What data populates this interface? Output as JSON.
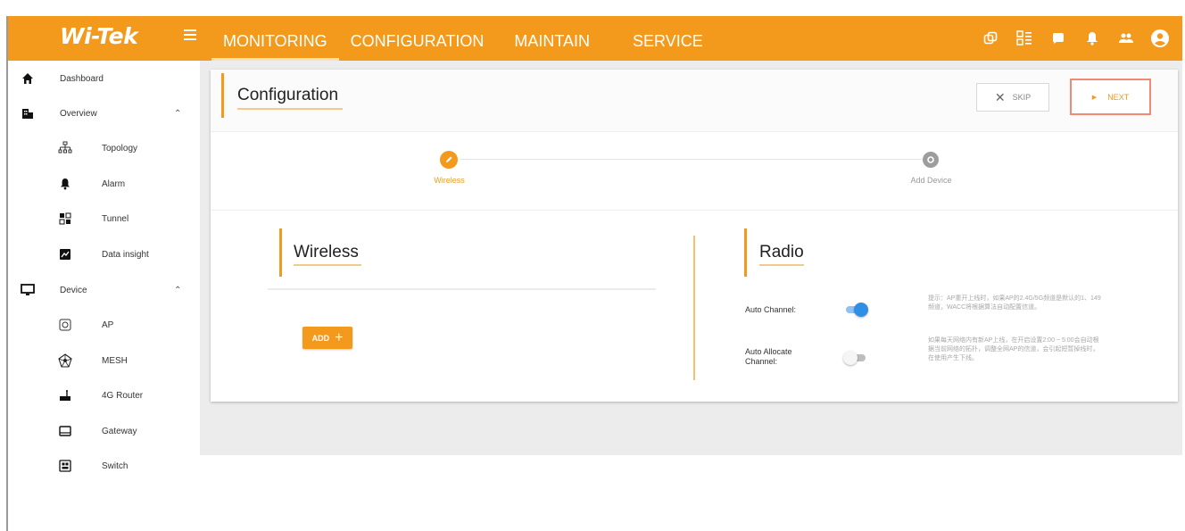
{
  "brand": {
    "logo_text": "Wi-Tek",
    "logo_tagline": "",
    "accent_color": "#f39a1c",
    "nav_text_color": "#ffffff"
  },
  "topnav": {
    "items": [
      {
        "label": "MONITORING",
        "active": true
      },
      {
        "label": "CONFIGURATION",
        "active": false
      },
      {
        "label": "MAINTAIN",
        "active": false
      },
      {
        "label": "SERVICE",
        "active": false
      }
    ],
    "icons": [
      "link-icon",
      "qr-grid-icon",
      "chat-icon",
      "bell-icon",
      "users-icon",
      "account-icon"
    ]
  },
  "sidebar": {
    "items": [
      {
        "label": "Dashboard",
        "icon": "home-icon",
        "level": "parent"
      },
      {
        "label": "Overview",
        "icon": "building-icon",
        "level": "parent",
        "expanded": true
      },
      {
        "label": "Topology",
        "icon": "topology-icon",
        "level": "child"
      },
      {
        "label": "Alarm",
        "icon": "bell-icon",
        "level": "child"
      },
      {
        "label": "Tunnel",
        "icon": "tunnel-icon",
        "level": "child"
      },
      {
        "label": "Data insight",
        "icon": "chart-icon",
        "level": "child"
      },
      {
        "label": "Device",
        "icon": "monitor-icon",
        "level": "parent",
        "expanded": true
      },
      {
        "label": "AP",
        "icon": "ap-icon",
        "level": "child"
      },
      {
        "label": "MESH",
        "icon": "mesh-icon",
        "level": "child"
      },
      {
        "label": "4G Router",
        "icon": "router-icon",
        "level": "child"
      },
      {
        "label": "Gateway",
        "icon": "gateway-icon",
        "level": "child"
      },
      {
        "label": "Switch",
        "icon": "switch-icon",
        "level": "child"
      }
    ]
  },
  "card": {
    "title": "Configuration",
    "skip_label": "SKIP",
    "next_label": "NEXT"
  },
  "stepper": {
    "steps": [
      {
        "label": "Wireless",
        "state": "active"
      },
      {
        "label": "Add Device",
        "state": "inactive"
      }
    ]
  },
  "wireless": {
    "title": "Wireless",
    "add_label": "ADD"
  },
  "radio": {
    "title": "Radio",
    "auto_channel_label": "Auto Channel:",
    "auto_channel_on": true,
    "auto_channel_hint": "提示：AP重开上线时，如果AP的2.4G/5G频道是默认的1、149频道，WACC将根据算法自动配置信道。",
    "auto_allocate_label": "Auto Allocate Channel:",
    "auto_allocate_on": false,
    "auto_allocate_hint": "如果每天网络内有新AP上线，在开启设置2:00 ~ 5:00会自动根据当前网络的拓扑，调整全网AP的信道，会引起短暂掉线时，在使用产生下线。"
  }
}
